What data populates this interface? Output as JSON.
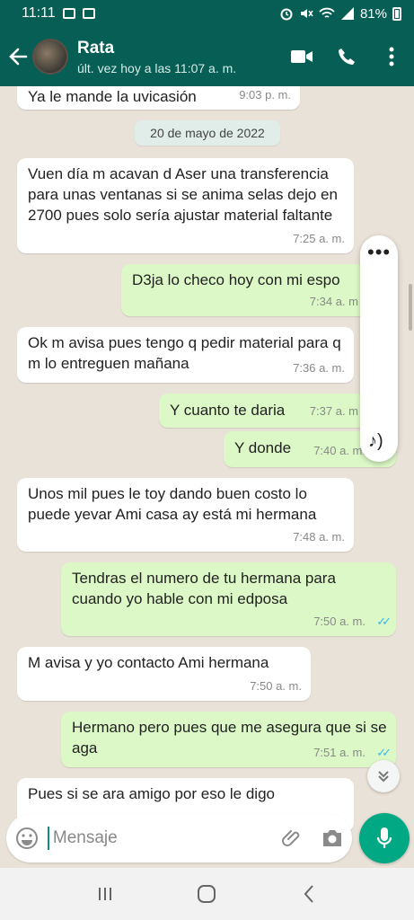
{
  "status_bar": {
    "time": "11:11",
    "battery": "81%"
  },
  "header": {
    "contact_name": "Rata",
    "last_seen": "últ. vez hoy a las 11:07 a. m."
  },
  "chat": {
    "date_chip": "20 de mayo de 2022",
    "messages": [
      {
        "direction": "in",
        "text": "Ya le mande la uvicasión",
        "time": "9:03 p. m."
      },
      {
        "direction": "in",
        "text": "Vuen día m acavan d Aser una transferencia para unas ventanas si se anima selas dejo en 2700 pues solo sería ajustar material faltante",
        "time": "7:25 a. m."
      },
      {
        "direction": "out",
        "text": "D3ja lo checo hoy con mi espo",
        "time": "7:34 a. m"
      },
      {
        "direction": "in",
        "text": "Ok m avisa pues tengo q pedir material para q m lo entreguen mañana",
        "time": "7:36 a. m."
      },
      {
        "direction": "out",
        "text": "Y cuanto te daria",
        "time": "7:37 a. m"
      },
      {
        "direction": "out",
        "text": "Y donde",
        "time": "7:40 a. m."
      },
      {
        "direction": "in",
        "text": "Unos mil pues le toy dando buen costo lo puede yevar Ami casa ay está mi hermana",
        "time": "7:48 a. m."
      },
      {
        "direction": "out",
        "text": "Tendras el numero de tu hermana para cuando yo hable con mi edposa",
        "time": "7:50 a. m."
      },
      {
        "direction": "in",
        "text": "M avisa y yo contacto Ami hermana",
        "time": "7:50 a. m."
      },
      {
        "direction": "out",
        "text": "Hermano pero pues que me asegura que si se aga",
        "time": "7:51 a. m."
      },
      {
        "direction": "in",
        "text": "Pues si se ara amigo por eso le digo",
        "time": ""
      }
    ]
  },
  "composer": {
    "placeholder": "Mensaje"
  },
  "colors": {
    "header": "#075e54",
    "outgoing_bubble": "#dcf8c6",
    "read_ticks": "#34b7f1",
    "mic_button": "#00a884"
  },
  "icons": [
    "back-arrow-icon",
    "video-call-icon",
    "phone-icon",
    "more-vert-icon",
    "emoji-icon",
    "attach-icon",
    "camera-icon",
    "mic-icon",
    "double-chevron-down-icon",
    "recents-icon",
    "home-icon",
    "nav-back-icon"
  ]
}
